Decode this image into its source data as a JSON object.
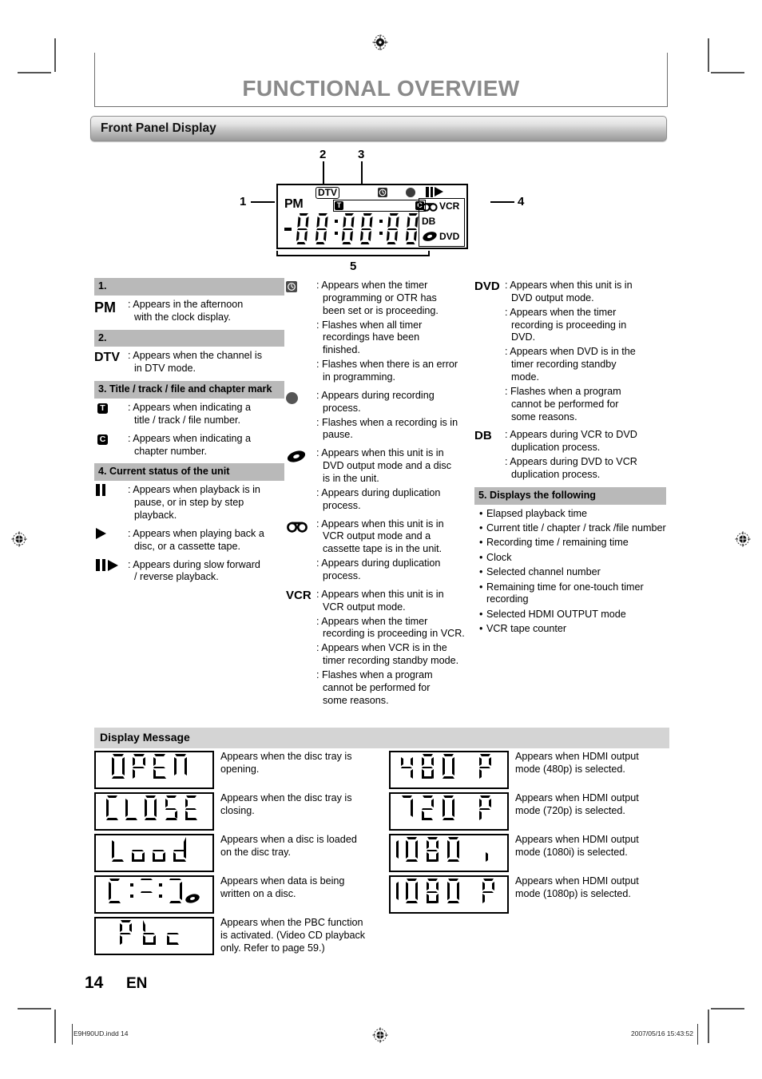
{
  "header": {
    "chapter_title": "FUNCTIONAL OVERVIEW",
    "section_title": "Front Panel Display"
  },
  "lcd_diagram": {
    "callouts": [
      "1",
      "2",
      "3",
      "4",
      "5"
    ],
    "indicators": {
      "pm": "PM",
      "dtv": "DTV",
      "title_badge": "T",
      "chapter_badge": "C",
      "vcr": "VCR",
      "db": "DB",
      "dvd": "DVD"
    }
  },
  "legend": {
    "col1": [
      {
        "header": "1.",
        "entries": [
          {
            "glyph": "PM",
            "glyph_kind": "text",
            "lines": [
              ": Appears in the afternoon",
              "with the clock display."
            ]
          }
        ]
      },
      {
        "header": "2.",
        "entries": [
          {
            "glyph": "DTV",
            "glyph_kind": "text",
            "lines": [
              ": Appears when the channel is",
              "in DTV mode."
            ]
          }
        ]
      },
      {
        "header": "3. Title / track / file and chapter mark",
        "entries": [
          {
            "glyph": "T",
            "glyph_kind": "badge",
            "lines": [
              ": Appears when indicating a",
              "title / track / file number."
            ]
          },
          {
            "glyph": "C",
            "glyph_kind": "badge",
            "lines": [
              ": Appears when indicating a",
              "chapter number."
            ]
          }
        ]
      },
      {
        "header": "4. Current status of the unit",
        "entries": [
          {
            "glyph": "pause-icon",
            "glyph_kind": "pause",
            "lines": [
              ": Appears when playback is in",
              "pause, or in step by step",
              "playback."
            ]
          },
          {
            "glyph": "play-icon",
            "glyph_kind": "play",
            "lines": [
              ": Appears when playing back a",
              "disc, or a cassette tape."
            ]
          },
          {
            "glyph": "slow-play-icon",
            "glyph_kind": "pauseplay",
            "lines": [
              ": Appears during slow forward",
              "/ reverse playback."
            ]
          }
        ]
      }
    ],
    "col2": [
      {
        "glyph": "clock-icon",
        "glyph_kind": "clock",
        "blocks": [
          [
            ": Appears when the timer",
            "programming or OTR has",
            "been set or is proceeding."
          ],
          [
            ": Flashes when all timer",
            "recordings have been",
            "finished."
          ],
          [
            ": Flashes when there is an error",
            "in programming."
          ]
        ]
      },
      {
        "glyph": "record-dot-icon",
        "glyph_kind": "dot",
        "blocks": [
          [
            ": Appears during recording",
            "process."
          ],
          [
            ": Flashes when a recording is in",
            "pause."
          ]
        ]
      },
      {
        "glyph": "disc-icon",
        "glyph_kind": "disc",
        "blocks": [
          [
            ": Appears when this unit is in",
            "DVD output mode and a disc",
            "is in the unit."
          ],
          [
            ": Appears during duplication",
            "process."
          ]
        ]
      },
      {
        "glyph": "cassette-icon",
        "glyph_kind": "tape",
        "blocks": [
          [
            ": Appears when this unit is in",
            "VCR output mode and a",
            "cassette tape is in the unit."
          ],
          [
            ": Appears during duplication",
            "process."
          ]
        ]
      },
      {
        "glyph": "VCR",
        "glyph_kind": "text",
        "blocks": [
          [
            ": Appears when this unit is in",
            "VCR output mode."
          ],
          [
            ": Appears when the timer",
            "recording is proceeding in VCR."
          ],
          [
            ": Appears when VCR is in the",
            "timer recording standby mode."
          ],
          [
            ": Flashes when a program",
            "cannot be performed for",
            "some reasons."
          ]
        ]
      }
    ],
    "col3": [
      {
        "glyph": "DVD",
        "glyph_kind": "text",
        "blocks": [
          [
            ": Appears when this unit is in",
            "DVD output mode."
          ],
          [
            ": Appears when the timer",
            "recording is proceeding in",
            "DVD."
          ],
          [
            ": Appears when DVD is in the",
            "timer recording standby",
            "mode."
          ],
          [
            ": Flashes when a program",
            "cannot be performed for",
            "some reasons."
          ]
        ]
      },
      {
        "glyph": "DB",
        "glyph_kind": "text",
        "blocks": [
          [
            ": Appears during VCR to DVD",
            "duplication process."
          ],
          [
            ": Appears during DVD to VCR",
            "duplication process."
          ]
        ]
      }
    ],
    "col3_header": "5. Displays the following",
    "col3_bullets": [
      "Elapsed playback time",
      "Current title / chapter / track /file number",
      "Recording time / remaining time",
      "Clock",
      "Selected channel number",
      "Remaining time for one-touch timer recording",
      "Selected HDMI OUTPUT mode",
      "VCR tape counter"
    ]
  },
  "display_message": {
    "title": "Display Message",
    "left": [
      {
        "lcd_text": "OPEN",
        "desc": [
          "Appears when the disc tray is",
          "opening."
        ]
      },
      {
        "lcd_text": "CLOSE",
        "desc": [
          "Appears when the disc tray is",
          "closing."
        ]
      },
      {
        "lcd_text": "Load",
        "desc": [
          "Appears when a disc is loaded",
          "on the disc tray."
        ]
      },
      {
        "lcd_text": "C===]",
        "lcd_disc": true,
        "desc": [
          "Appears when data is being",
          "written on a disc."
        ]
      },
      {
        "lcd_text": "Pbc",
        "desc": [
          "Appears when the PBC function",
          "is activated. (Video CD playback",
          "only. Refer to page 59.)"
        ]
      }
    ],
    "right": [
      {
        "lcd_text": "480 P",
        "desc": [
          "Appears when HDMI output",
          "mode (480p) is selected."
        ]
      },
      {
        "lcd_text": "720 P",
        "desc": [
          "Appears when HDMI output",
          "mode (720p) is selected."
        ]
      },
      {
        "lcd_text": "1080 i",
        "desc": [
          "Appears when HDMI output",
          "mode (1080i) is selected."
        ]
      },
      {
        "lcd_text": "1080 P",
        "desc": [
          "Appears when HDMI output",
          "mode (1080p) is selected."
        ]
      }
    ]
  },
  "footer": {
    "page_number": "14",
    "language": "EN",
    "file_name": "E9H90UD.indd   14",
    "timestamp": "2007/05/16   15:43:52"
  }
}
